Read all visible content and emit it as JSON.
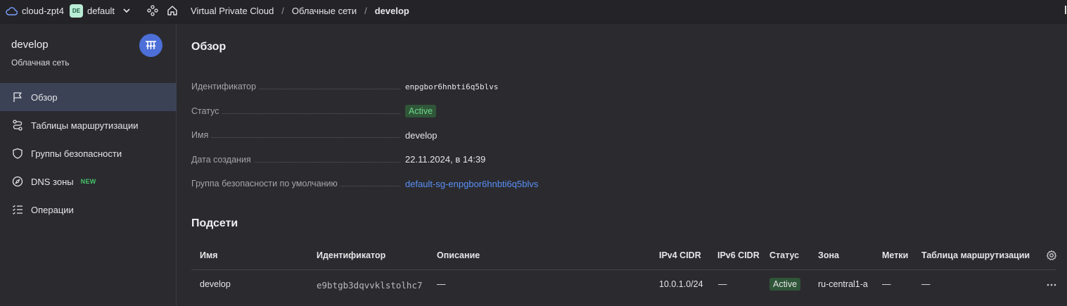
{
  "topbar": {
    "cloud_name": "cloud-zpt4",
    "folder_badge": "DE",
    "folder_name": "default",
    "breadcrumbs": [
      "Virtual Private Cloud",
      "Облачные сети",
      "develop"
    ],
    "separator": "/"
  },
  "sidebar": {
    "title": "develop",
    "subtitle": "Облачная сеть",
    "items": [
      {
        "label": "Обзор",
        "icon": "flag-icon",
        "active": true
      },
      {
        "label": "Таблицы маршрутизации",
        "icon": "route-icon"
      },
      {
        "label": "Группы безопасности",
        "icon": "shield-icon"
      },
      {
        "label": "DNS зоны",
        "icon": "compass-icon",
        "badge": "NEW"
      },
      {
        "label": "Операции",
        "icon": "list-check-icon"
      }
    ]
  },
  "overview": {
    "heading": "Обзор",
    "rows": [
      {
        "label": "Идентификатор",
        "value": "enpgbor6hnbti6q5blvs"
      },
      {
        "label": "Статус",
        "value": "Active"
      },
      {
        "label": "Имя",
        "value": "develop"
      },
      {
        "label": "Дата создания",
        "value": "22.11.2024, в 14:39"
      },
      {
        "label": "Группа безопасности по умолчанию",
        "value": "default-sg-enpgbor6hnbti6q5blvs"
      }
    ]
  },
  "subnets": {
    "heading": "Подсети",
    "columns": [
      "Имя",
      "Идентификатор",
      "Описание",
      "IPv4 CIDR",
      "IPv6 CIDR",
      "Статус",
      "Зона",
      "Метки",
      "Таблица маршрутизации"
    ],
    "rows": [
      {
        "name": "develop",
        "id": "e9btgb3dqvvklstolhc7",
        "description": "—",
        "ipv4": "10.0.1.0/24",
        "ipv6": "—",
        "status": "Active",
        "zone": "ru-central1-a",
        "labels": "—",
        "route_table": "—"
      }
    ]
  },
  "colors": {
    "accent": "#4c6fd8",
    "status_active_bg": "#2f5638",
    "status_active_text": "#6fd68a",
    "link": "#5a8ff6",
    "new_badge": "#45c36a"
  }
}
